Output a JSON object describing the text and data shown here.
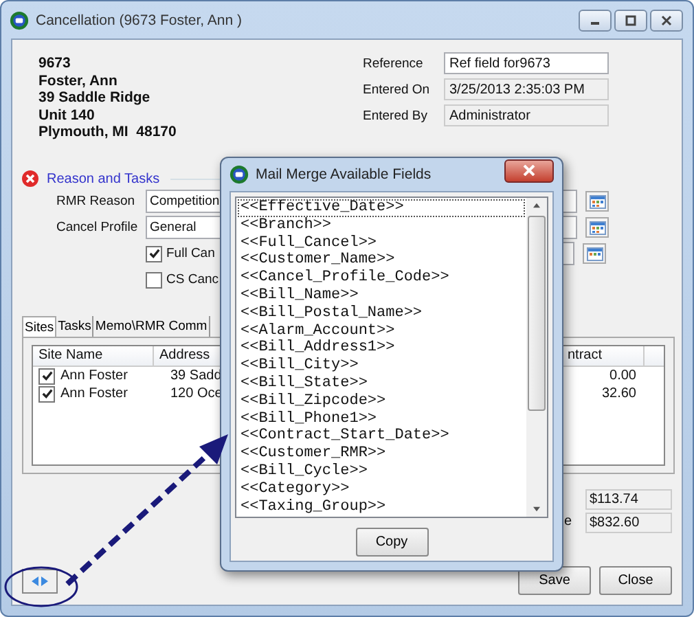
{
  "window": {
    "title": "Cancellation (9673 Foster, Ann )"
  },
  "address": [
    "9673",
    "Foster, Ann",
    "39 Saddle Ridge",
    "Unit 140",
    "Plymouth, MI  48170"
  ],
  "info_fields": [
    {
      "label": "Reference",
      "value": "Ref field for9673",
      "disabled": false
    },
    {
      "label": "Entered On",
      "value": "3/25/2013 2:35:03 PM",
      "disabled": true
    },
    {
      "label": "Entered By",
      "value": "Administrator",
      "disabled": true
    }
  ],
  "reason_section": {
    "title": "Reason and Tasks",
    "fields": [
      {
        "label": "RMR Reason",
        "value": "Competition"
      },
      {
        "label": "Cancel Profile",
        "value": "General"
      }
    ],
    "checkboxes": [
      {
        "label": "Full Can",
        "checked": true
      },
      {
        "label": "CS Canc",
        "checked": false
      }
    ]
  },
  "tabs": [
    {
      "label": "Sites",
      "selected": true
    },
    {
      "label": "Tasks",
      "selected": false
    },
    {
      "label": "Memo\\RMR Comm",
      "selected": false
    }
  ],
  "sites_table": {
    "columns": [
      "Site Name",
      "Address",
      "ntract"
    ],
    "rows": [
      {
        "checked": true,
        "cells": [
          "Ann Foster",
          "39 Sadd",
          "0.00"
        ]
      },
      {
        "checked": true,
        "cells": [
          "Ann Foster",
          "120 Oce",
          "32.60"
        ]
      }
    ]
  },
  "totals": {
    "label": "e",
    "values": [
      "$113.74",
      "$832.60"
    ]
  },
  "buttons": [
    "Save",
    "Close"
  ],
  "dialog": {
    "title": "Mail Merge Available Fields",
    "button": "Copy",
    "fields": [
      {
        "text": "<<Effective_Date>>",
        "selected": true
      },
      {
        "text": "<<Branch>>",
        "selected": false
      },
      {
        "text": "<<Full_Cancel>>",
        "selected": false
      },
      {
        "text": "<<Customer_Name>>",
        "selected": false
      },
      {
        "text": "<<Cancel_Profile_Code>>",
        "selected": false
      },
      {
        "text": "<<Bill_Name>>",
        "selected": false
      },
      {
        "text": "<<Bill_Postal_Name>>",
        "selected": false
      },
      {
        "text": "<<Alarm_Account>>",
        "selected": false
      },
      {
        "text": "<<Bill_Address1>>",
        "selected": false
      },
      {
        "text": "<<Bill_City>>",
        "selected": false
      },
      {
        "text": "<<Bill_State>>",
        "selected": false
      },
      {
        "text": "<<Bill_Zipcode>>",
        "selected": false
      },
      {
        "text": "<<Bill_Phone1>>",
        "selected": false
      },
      {
        "text": "<<Contract_Start_Date>>",
        "selected": false
      },
      {
        "text": "<<Customer_RMR>>",
        "selected": false
      },
      {
        "text": "<<Bill_Cycle>>",
        "selected": false
      },
      {
        "text": "<<Category>>",
        "selected": false
      },
      {
        "text": "<<Taxing_Group>>",
        "selected": false
      }
    ]
  }
}
